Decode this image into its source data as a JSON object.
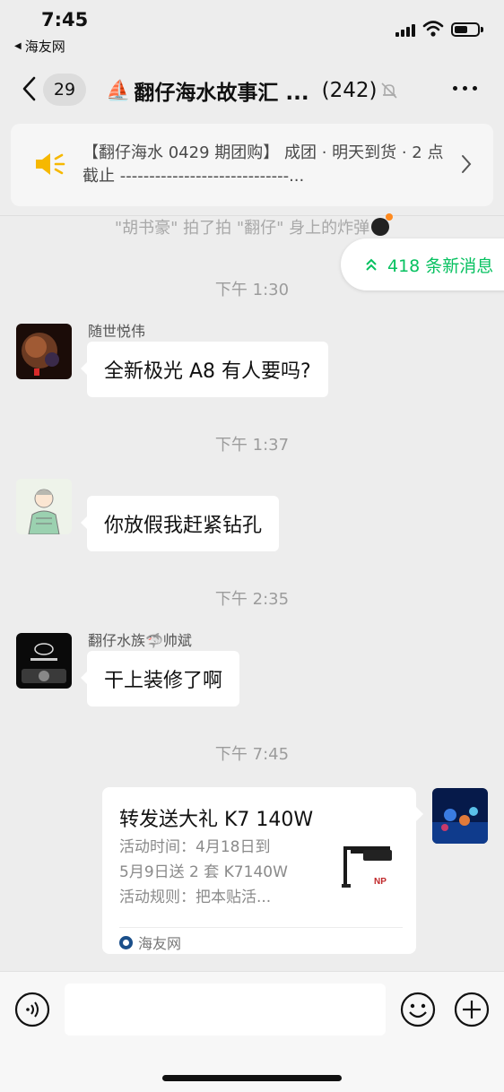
{
  "status_bar": {
    "time": "7:45",
    "back_app": "海友网"
  },
  "nav": {
    "unread_count": "29",
    "title": "翻仔海水故事汇 ...",
    "member_count": "(242)"
  },
  "notice": {
    "text": "【翻仔海水 0429 期团购】 成团 · 明天到货 · 2 点截止 -----------------------------..."
  },
  "system_message": "\"胡书豪\" 拍了拍 \"翻仔\" 身上的炸弹",
  "new_messages": "418 条新消息",
  "messages": [
    {
      "time": "下午 1:30",
      "sender": "随世悦伟",
      "text": "全新极光 A8 有人要吗?"
    },
    {
      "time": "下午 1:37",
      "sender": "",
      "text": "你放假我赶紧钻孔"
    },
    {
      "time": "下午 2:35",
      "sender": "翻仔水族🦈帅斌",
      "text": "干上装修了啊"
    },
    {
      "time": "下午 7:45"
    }
  ],
  "card": {
    "title": "转发送大礼 K7 140W",
    "desc_lines": [
      "活动时间：4月18日到",
      "5月9日送 2 套 K7140W",
      "活动规则：把本贴活..."
    ],
    "source": "海友网"
  },
  "colors": {
    "accent_green": "#07c160",
    "background": "#ededed",
    "speaker_yellow": "#f6b800"
  }
}
